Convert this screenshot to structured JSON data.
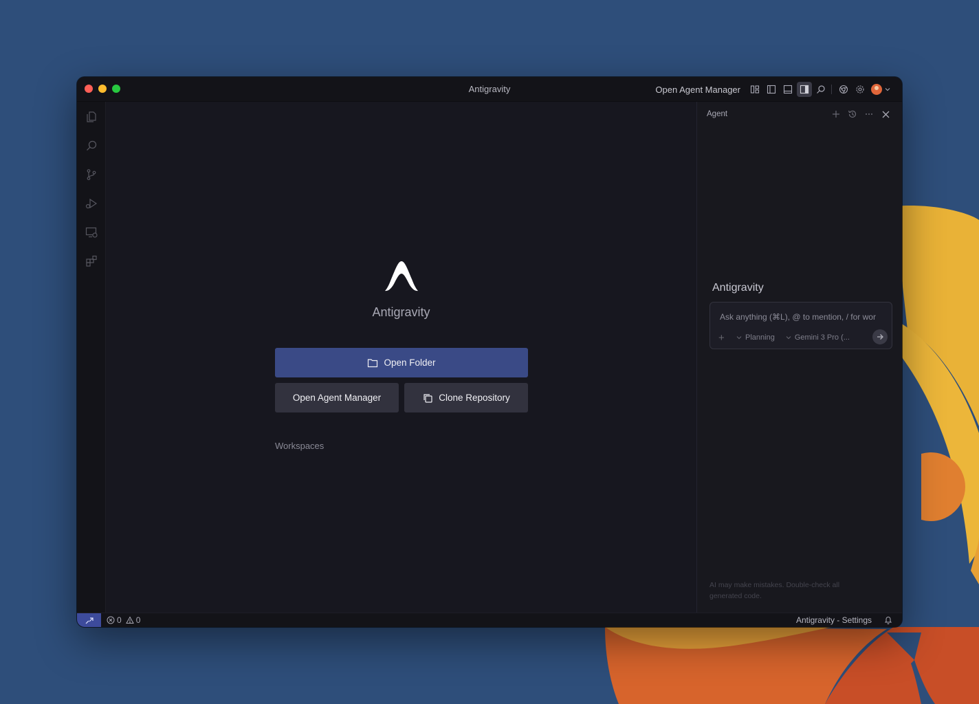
{
  "window": {
    "title": "Antigravity"
  },
  "titlebar": {
    "open_agent_manager": "Open Agent Manager",
    "icons": [
      "layout-icon",
      "toggle-primary-sidebar-icon",
      "toggle-panel-icon",
      "toggle-secondary-sidebar-icon",
      "search-icon",
      "chrome-icon",
      "settings-gear-icon",
      "account-avatar"
    ]
  },
  "activity_bar": {
    "icons": [
      "explorer-icon",
      "search-icon",
      "source-control-icon",
      "run-debug-icon",
      "remote-explorer-icon",
      "extensions-icon"
    ]
  },
  "welcome": {
    "app_name": "Antigravity",
    "open_folder": "Open Folder",
    "open_agent_manager": "Open Agent Manager",
    "clone_repository": "Clone Repository",
    "workspaces_heading": "Workspaces"
  },
  "agent_panel": {
    "header": "Agent",
    "title": "Antigravity",
    "input_placeholder": "Ask anything (⌘L), @ to mention, / for wor",
    "add_label": "+",
    "mode_label": "Planning",
    "model_label": "Gemini 3 Pro (...",
    "disclaimer": "AI may make mistakes. Double-check all generated code."
  },
  "status_bar": {
    "errors": "0",
    "warnings": "0",
    "settings_label": "Antigravity - Settings"
  },
  "colors": {
    "desktop": "#2e4e7a",
    "accent": "#3a4a86",
    "remote_indicator": "#3d4b9c"
  }
}
